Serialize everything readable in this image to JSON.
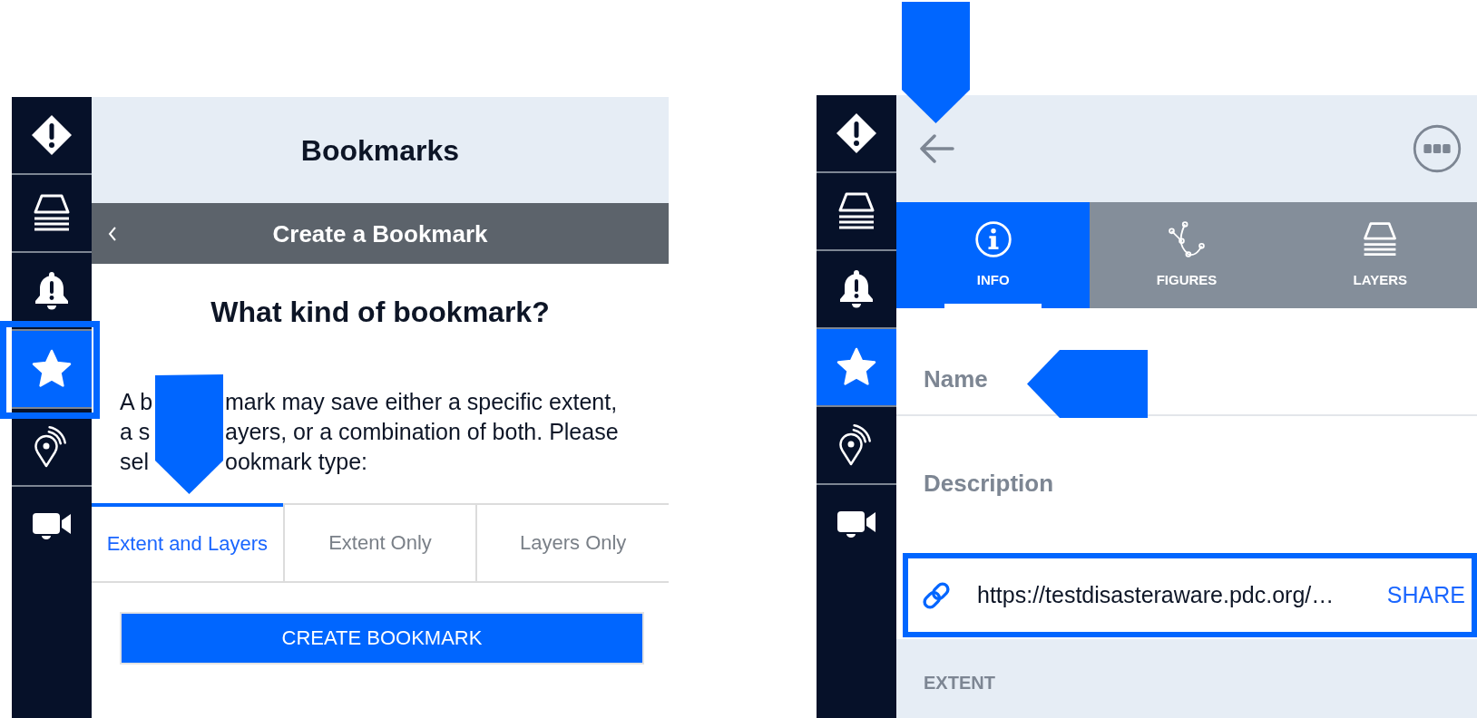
{
  "left_panel": {
    "sidebar": [
      {
        "kind": "warning",
        "selected": false,
        "framed": false
      },
      {
        "kind": "layers",
        "selected": false,
        "framed": false
      },
      {
        "kind": "bell",
        "selected": false,
        "framed": false
      },
      {
        "kind": "star",
        "selected": true,
        "framed": true
      },
      {
        "kind": "pin",
        "selected": false,
        "framed": false
      },
      {
        "kind": "video",
        "selected": false,
        "framed": false
      }
    ],
    "header": {
      "title": "Bookmarks"
    },
    "subheader": {
      "title": "Create a Bookmark"
    },
    "question": "What kind of bookmark?",
    "intro_lines": [
      {
        "before": "A b",
        "after": "mark may save either a specific extent,"
      },
      {
        "before": "a s",
        "after": "ayers, or a combination of both. Please"
      },
      {
        "before": "sel",
        "after": "ookmark type:"
      }
    ],
    "bookmark_types": [
      {
        "label": "Extent and Layers",
        "selected": true,
        "pointed_at": true
      },
      {
        "label": "Extent Only",
        "selected": false,
        "pointed_at": false
      },
      {
        "label": "Layers Only",
        "selected": false,
        "pointed_at": false
      }
    ],
    "create_button": {
      "label": "CREATE BOOKMARK"
    }
  },
  "right_panel": {
    "sidebar": [
      {
        "kind": "warning",
        "selected": false
      },
      {
        "kind": "layers",
        "selected": false
      },
      {
        "kind": "bell",
        "selected": false
      },
      {
        "kind": "star",
        "selected": true
      },
      {
        "kind": "pin",
        "selected": false
      },
      {
        "kind": "video",
        "selected": false
      }
    ],
    "header": {
      "back_pointed_at": true
    },
    "tabs": [
      {
        "kind": "info",
        "label": "INFO",
        "selected": true
      },
      {
        "kind": "figures",
        "label": "FIGURES",
        "selected": false
      },
      {
        "kind": "layers",
        "label": "LAYERS",
        "selected": false
      }
    ],
    "fields": [
      {
        "placeholder": "Name",
        "pointed_at": true
      },
      {
        "placeholder": "Description",
        "pointed_at": false
      }
    ],
    "share_link": {
      "url": "https://testdisasteraware.pdc.org/…",
      "action": "SHARE",
      "framed": true
    },
    "section": {
      "title": "EXTENT"
    }
  }
}
